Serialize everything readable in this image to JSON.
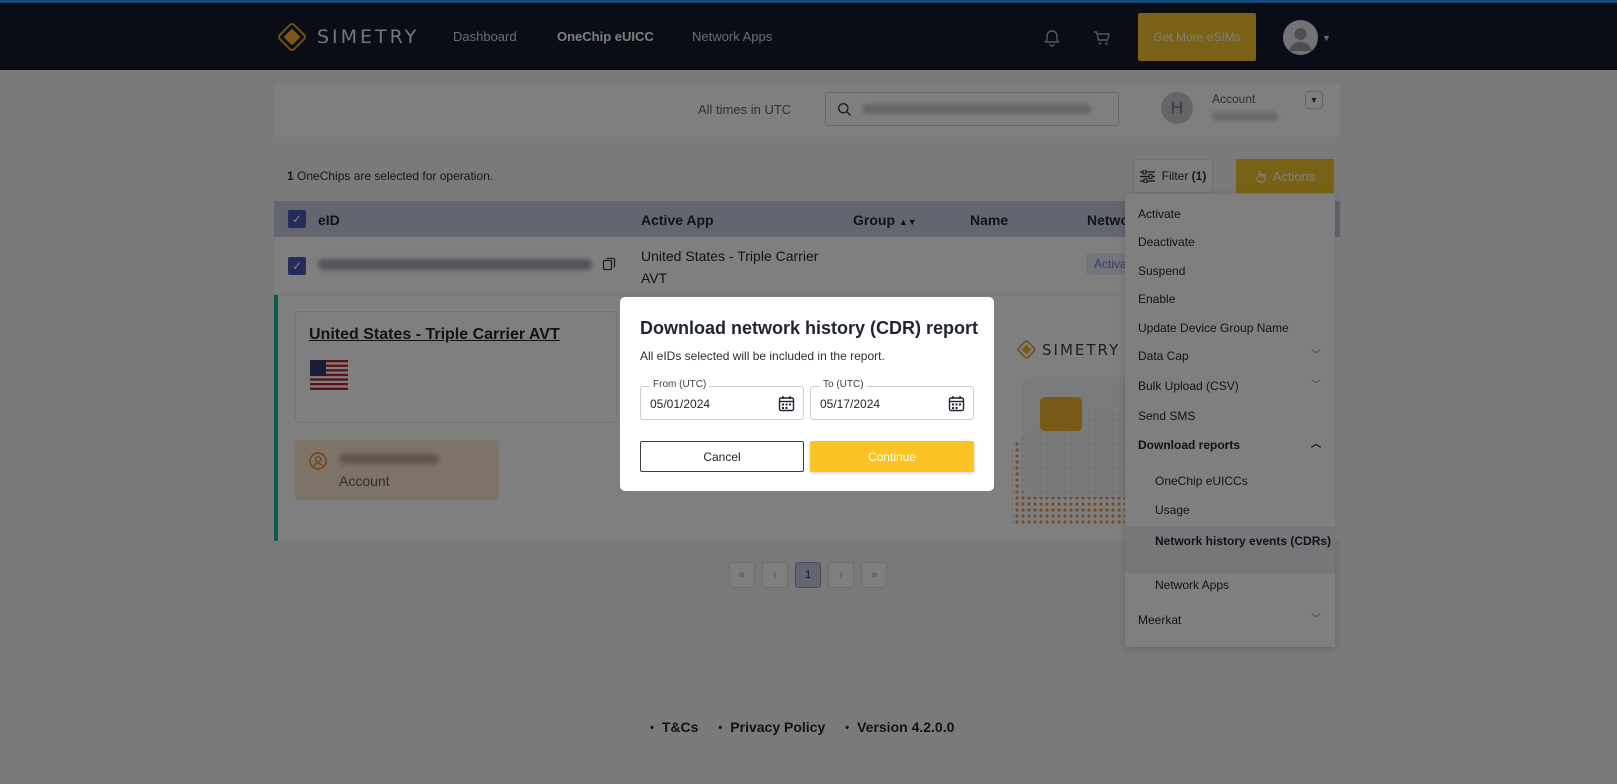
{
  "nav": {
    "brand": "SIMETRY",
    "links": [
      {
        "label": "Dashboard"
      },
      {
        "label": "OneChip eUICC"
      },
      {
        "label": "Network Apps"
      }
    ],
    "cta_label": "Get More eSIMs"
  },
  "subheader": {
    "times_label": "All times in UTC",
    "account_label": "Account",
    "account_initial": "H"
  },
  "selection": {
    "count": "1",
    "text": " OneChips are selected for operation."
  },
  "toolbar": {
    "filter_label": "Filter",
    "filter_count": "(1)",
    "actions_label": "Actions"
  },
  "table": {
    "columns": [
      "eID",
      "Active App",
      "Group",
      "Name",
      "Netwo"
    ],
    "row": {
      "active_app": "United States - Triple Carrier AVT",
      "status": "Activa"
    }
  },
  "detail": {
    "card_title": "United States - Triple Carrier AVT",
    "account_label": "Account",
    "sim_brand": "SIMETRY"
  },
  "pager": {
    "current": "1"
  },
  "footer": {
    "links": [
      "T&Cs",
      "Privacy Policy",
      "Version 4.2.0.0"
    ]
  },
  "actions_menu": {
    "items": [
      "Activate",
      "Deactivate",
      "Suspend",
      "Enable",
      "Update Device Group Name",
      "Data Cap",
      "Bulk Upload (CSV)",
      "Send SMS",
      "Download reports",
      "OneChip eUICCs",
      "Usage",
      "Network history events (CDRs)",
      "Network Apps",
      "Meerkat"
    ]
  },
  "modal": {
    "title": "Download network history (CDR) report",
    "subtitle": "All eIDs selected will be included in the report.",
    "from_label": "From (UTC)",
    "from_value": "05/01/2024",
    "to_label": "To (UTC)",
    "to_value": "05/17/2024",
    "cancel_label": "Cancel",
    "continue_label": "Continue"
  },
  "colors": {
    "nav_bg": "#161a2c",
    "accent_yellow": "#f2c52a",
    "header_row": "#c7cbe2",
    "teal": "#1fb29c",
    "link_blue": "#6a78d8"
  }
}
